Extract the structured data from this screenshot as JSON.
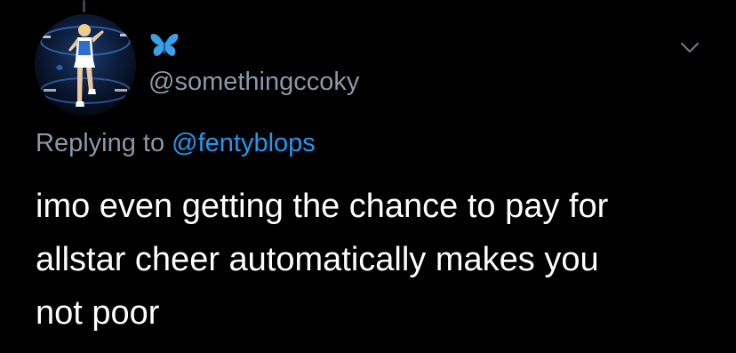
{
  "tweet": {
    "display_name_icon": "blue-butterfly-emoji",
    "handle": "@somethingccoky",
    "replying_prefix": "Replying to",
    "replying_to": "@fentyblops",
    "text_lines": [
      "imo even getting the chance to pay for",
      "allstar cheer automatically makes you",
      "not poor"
    ],
    "menu_icon": "chevron-down-icon"
  },
  "colors": {
    "background": "#000000",
    "primary_text": "#ffffff",
    "secondary_text": "#8b98a5",
    "link": "#1d9bf0",
    "butterfly": "#3aa0e8"
  }
}
